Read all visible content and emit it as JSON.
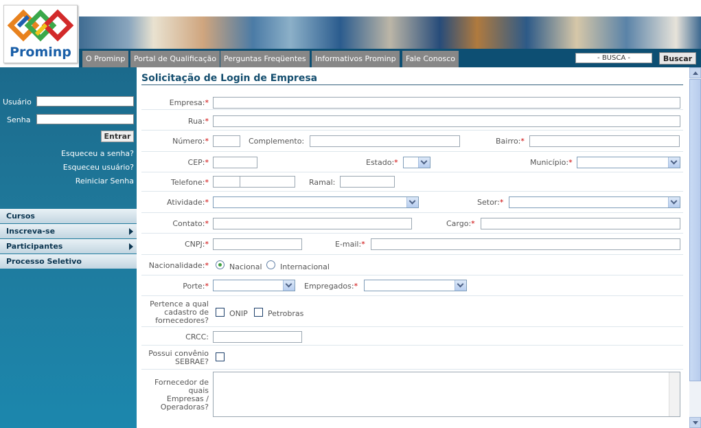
{
  "brand": {
    "name": "Prominp"
  },
  "nav": {
    "tabs": [
      "O Prominp",
      "Portal de Qualificação",
      "Perguntas Freqüentes",
      "Informativos Prominp",
      "Fale Conosco"
    ],
    "search_value": "- BUSCA -",
    "search_button": "Buscar"
  },
  "login": {
    "user_label": "Usuário",
    "password_label": "Senha",
    "enter_button": "Entrar",
    "forgot_password": "Esqueceu a senha?",
    "forgot_user": "Esqueceu usuário?",
    "reset_password": "Reiniciar Senha"
  },
  "menu": {
    "items": [
      {
        "label": "Cursos",
        "submenu": false
      },
      {
        "label": "Inscreva-se",
        "submenu": true
      },
      {
        "label": "Participantes",
        "submenu": true
      },
      {
        "label": "Processo Seletivo",
        "submenu": false
      }
    ]
  },
  "form": {
    "title": "Solicitação de Login de Empresa",
    "required_mark": "*",
    "empresa": "Empresa:",
    "rua": "Rua:",
    "numero": "Número:",
    "complemento": "Complemento:",
    "bairro": "Bairro:",
    "cep": "CEP:",
    "estado": "Estado:",
    "municipio": "Município:",
    "telefone": "Telefone:",
    "ramal": "Ramal:",
    "atividade": "Atividade:",
    "setor": "Setor:",
    "contato": "Contato:",
    "cargo": "Cargo:",
    "cnpj": "CNPJ:",
    "email": "E-mail:",
    "nacionalidade": "Nacionalidade:",
    "nacional": "Nacional",
    "internacional": "Internacional",
    "porte": "Porte:",
    "empregados": "Empregados:",
    "cadastro_l1": "Pertence a qual",
    "cadastro_l2": "cadastro de",
    "cadastro_l3": "fornecedores?",
    "onip": "ONIP",
    "petrobras": "Petrobras",
    "crcc": "CRCC:",
    "sebrae_l1": "Possui convênio",
    "sebrae_l2": "SEBRAE?",
    "fornecedor_l1": "Fornecedor de",
    "fornecedor_l2": "quais",
    "fornecedor_l3": "Empresas /",
    "fornecedor_l4": "Operadoras?"
  }
}
